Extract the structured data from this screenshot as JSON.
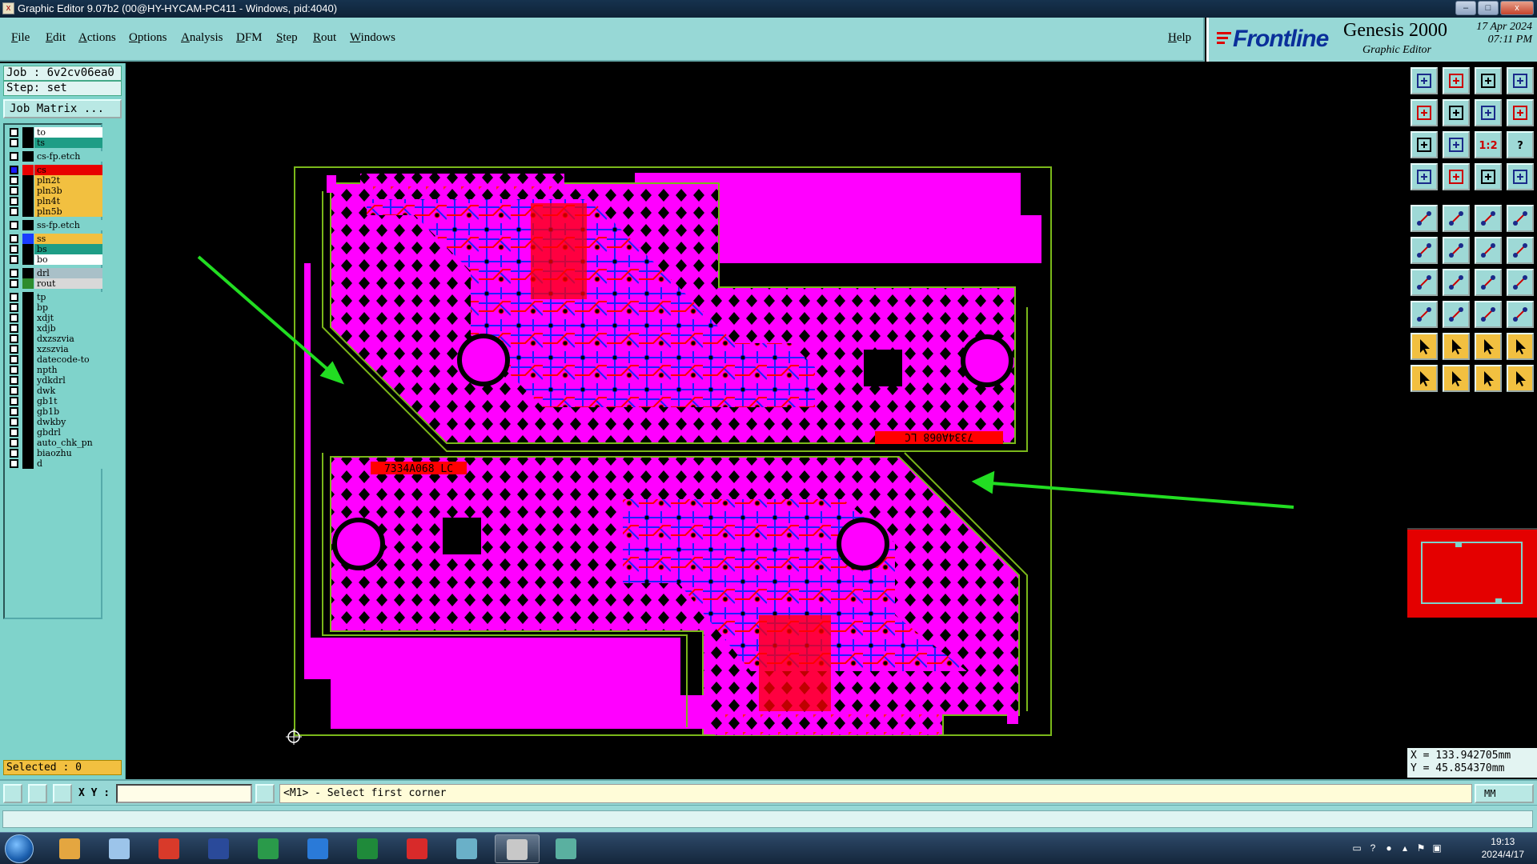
{
  "window": {
    "title": "Graphic Editor 9.07b2 (00@HY-HYCAM-PC411 - Windows, pid:4040)",
    "buttons": {
      "minimize": "–",
      "maximize": "□",
      "close": "x"
    }
  },
  "menu": {
    "items": [
      "File",
      "Edit",
      "Actions",
      "Options",
      "Analysis",
      "DFM",
      "Step",
      "Rout",
      "Windows"
    ],
    "help": "Help"
  },
  "brand": {
    "logo": "Frontline",
    "product": "Genesis 2000",
    "subtitle": "Graphic Editor",
    "date": "17 Apr 2024",
    "time": "07:11 PM"
  },
  "job": {
    "job_line": "Job : 6v2cv06ea0",
    "step_line": "Step: set",
    "job_matrix_button": "Job Matrix ..."
  },
  "layers": [
    {
      "name": "to",
      "color": "#ffffff",
      "swatch": "#000000",
      "checked": false
    },
    {
      "name": "ts",
      "color": "#1f9d86",
      "swatch": "#000000",
      "checked": false
    },
    {
      "name": "cs-fp.etch",
      "color": "#7fd3cb",
      "swatch": "#000000",
      "checked": false,
      "gap": true
    },
    {
      "name": "cs",
      "color": "#e80000",
      "swatch": "#e80000",
      "checked": true,
      "gap": true
    },
    {
      "name": "pln2t",
      "color": "#f2c040",
      "swatch": "#000000",
      "checked": false
    },
    {
      "name": "pln3b",
      "color": "#f2c040",
      "swatch": "#000000",
      "checked": false
    },
    {
      "name": "pln4t",
      "color": "#f2c040",
      "swatch": "#000000",
      "checked": false
    },
    {
      "name": "pln5b",
      "color": "#f2c040",
      "swatch": "#000000",
      "checked": false
    },
    {
      "name": "ss-fp.etch",
      "color": "#7fd3cb",
      "swatch": "#000000",
      "checked": false,
      "gap": true
    },
    {
      "name": "ss",
      "color": "#f2c040",
      "swatch": "#1a3cff",
      "checked": false,
      "gap": true
    },
    {
      "name": "bs",
      "color": "#1f9d86",
      "swatch": "#000000",
      "checked": false
    },
    {
      "name": "bo",
      "color": "#ffffff",
      "swatch": "#000000",
      "checked": false
    },
    {
      "name": "drl",
      "color": "#a9c0c8",
      "swatch": "#000000",
      "checked": false,
      "gap": true
    },
    {
      "name": "rout",
      "color": "#d8d8d8",
      "swatch": "#2e8b2e",
      "checked": false
    },
    {
      "name": "tp",
      "color": "#7fd3cb",
      "swatch": "#000000",
      "checked": false,
      "gap": true
    },
    {
      "name": "bp",
      "color": "#7fd3cb",
      "swatch": "#000000",
      "checked": false
    },
    {
      "name": "xdjt",
      "color": "#7fd3cb",
      "swatch": "#000000",
      "checked": false
    },
    {
      "name": "xdjb",
      "color": "#7fd3cb",
      "swatch": "#000000",
      "checked": false
    },
    {
      "name": "dxzszvia",
      "color": "#7fd3cb",
      "swatch": "#000000",
      "checked": false
    },
    {
      "name": "xzszvia",
      "color": "#7fd3cb",
      "swatch": "#000000",
      "checked": false
    },
    {
      "name": "datecode-to",
      "color": "#7fd3cb",
      "swatch": "#000000",
      "checked": false
    },
    {
      "name": "npth",
      "color": "#7fd3cb",
      "swatch": "#000000",
      "checked": false
    },
    {
      "name": "ydkdrl",
      "color": "#7fd3cb",
      "swatch": "#000000",
      "checked": false
    },
    {
      "name": "dwk",
      "color": "#7fd3cb",
      "swatch": "#000000",
      "checked": false
    },
    {
      "name": "gb1t",
      "color": "#7fd3cb",
      "swatch": "#000000",
      "checked": false
    },
    {
      "name": "gb1b",
      "color": "#7fd3cb",
      "swatch": "#000000",
      "checked": false
    },
    {
      "name": "dwkby",
      "color": "#7fd3cb",
      "swatch": "#000000",
      "checked": false
    },
    {
      "name": "gbdrl",
      "color": "#7fd3cb",
      "swatch": "#000000",
      "checked": false
    },
    {
      "name": "auto_chk_pn",
      "color": "#7fd3cb",
      "swatch": "#000000",
      "checked": false
    },
    {
      "name": "biaozhu",
      "color": "#7fd3cb",
      "swatch": "#000000",
      "checked": false
    },
    {
      "name": "d",
      "color": "#7fd3cb",
      "swatch": "#000000",
      "checked": false
    }
  ],
  "selected_text": "Selected : 0",
  "board": {
    "top_panel_label": "7334A068 LC",
    "bottom_panel_label": "7334A068 LC",
    "colors": {
      "cs_layer": "#ff00ff",
      "copper": "#ff0000",
      "ss_layer": "#1a1aff",
      "outline": "#7ab81a",
      "annotation_arrow": "#22dd22"
    }
  },
  "toolbar_icons": [
    "zoom-home-icon",
    "zoom-in-icon",
    "home-icon",
    "window-icon",
    "pan-left-icon",
    "pan-right-icon",
    "zoom-fit-icon",
    "split-icon",
    "zoom-area-icon",
    "center-icon",
    "ratio-icon",
    "help-icon",
    "snap-icon",
    "grid-icon",
    "layers-icon",
    "layers-alt-icon",
    "feature-icon",
    "feature-edit-icon",
    "ruler-icon",
    "pad-icon",
    "connect-icon",
    "delete-icon",
    "line-icon",
    "line-alt-icon",
    "angle-icon",
    "slash-icon",
    "arc-icon",
    "distance-icon",
    "pad-edit-icon",
    "minus-icon",
    "resize-icon",
    "pattern-icon",
    "triangle-icon",
    "triangle-a-icon",
    "triangle-b-icon",
    "triangle-c-icon",
    "pointer-icon",
    "pointer-alt-icon",
    "pointer-select-icon",
    "pointer-measure-icon"
  ],
  "text_icons": {
    "ratio-icon": "1:2",
    "help-icon": "?"
  },
  "coords": {
    "x": "X = 133.942705mm",
    "y": "Y = 45.854370mm"
  },
  "command": {
    "xy_label": "X Y :",
    "xy_value": "",
    "prompt": "<M1> - Select first corner",
    "units": "MM"
  },
  "taskbar": {
    "apps": [
      "shell-icon",
      "notepad-icon",
      "browser-icon",
      "save-icon",
      "publisher-icon",
      "arrow-app-icon",
      "excel-icon",
      "pdf-icon",
      "eye-app-icon",
      "genesis-icon",
      "viewer-icon"
    ],
    "active_app": "genesis-icon",
    "clock_time": "19:13",
    "clock_date": "2024/4/17"
  }
}
